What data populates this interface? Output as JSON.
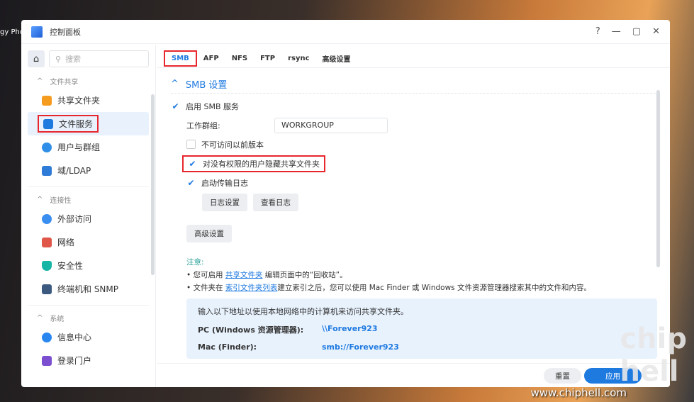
{
  "window": {
    "title": "控制面板",
    "controls": [
      "?",
      "—",
      "▢",
      "✕"
    ]
  },
  "sidebar": {
    "search_placeholder": "搜索",
    "sections": [
      {
        "label": "文件共享",
        "items": [
          {
            "label": "共享文件夹",
            "color": "#f59b1d"
          },
          {
            "label": "文件服务",
            "color": "#1f7ae0",
            "active": true
          },
          {
            "label": "用户与群组",
            "color": "#2f8fe8"
          },
          {
            "label": "域/LDAP",
            "color": "#2f7bd8"
          }
        ]
      },
      {
        "label": "连接性",
        "items": [
          {
            "label": "外部访问",
            "color": "#3a8ef0"
          },
          {
            "label": "网络",
            "color": "#e0574a"
          },
          {
            "label": "安全性",
            "color": "#16b5a5"
          },
          {
            "label": "终端机和 SNMP",
            "color": "#3c5a80"
          }
        ]
      },
      {
        "label": "系统",
        "items": [
          {
            "label": "信息中心",
            "color": "#2a86ef"
          },
          {
            "label": "登录门户",
            "color": "#7b4fd0"
          }
        ]
      }
    ]
  },
  "tabs": [
    "SMB",
    "AFP",
    "NFS",
    "FTP",
    "rsync",
    "高级设置"
  ],
  "smb": {
    "section_title": "SMB 设置",
    "enable_label": "启用 SMB 服务",
    "workgroup_label": "工作群组:",
    "workgroup_value": "WORKGROUP",
    "prev_versions_label": "不可访问以前版本",
    "hide_label": "对没有权限的用户隐藏共享文件夹",
    "log_label": "启动传输日志",
    "log_settings": "日志设置",
    "view_logs": "查看日志",
    "advanced": "高级设置",
    "note_title": "注意:",
    "note1_pre": "您可启用 ",
    "note1_link": "共享文件夹",
    "note1_post": " 编辑页面中的“回收站”。",
    "note2_pre": "文件夹在 ",
    "note2_link": "索引文件夹列表",
    "note2_post": "建立索引之后，您可以使用 Mac Finder 或 Windows 文件资源管理器搜索其中的文件和内容。",
    "info_intro": "输入以下地址以使用本地网络中的计算机来访问共享文件夹。",
    "pc_label": "PC (Windows 资源管理器):",
    "pc_value": "\\\\Forever923",
    "mac_label": "Mac (Finder):",
    "mac_value": "smb://Forever923"
  },
  "footer": {
    "reset": "重置",
    "apply": "应用"
  },
  "watermark": "www.chiphell.com"
}
